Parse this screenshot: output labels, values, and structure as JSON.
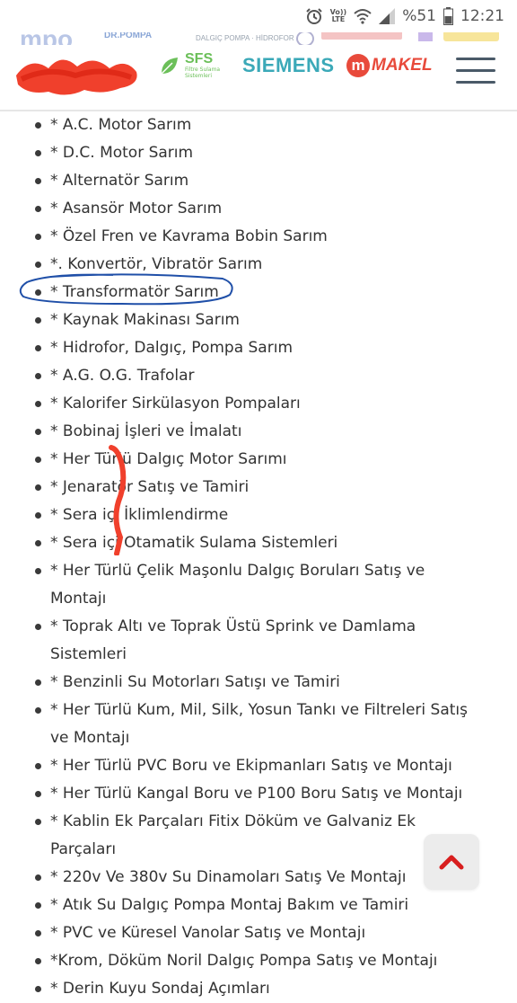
{
  "status_bar": {
    "volte": "Vo))",
    "lte": "LTE",
    "battery": "%51",
    "time": "12:21"
  },
  "header": {
    "brand_strip": [
      "DALGIÇ POMPA · HİDROFOR"
    ],
    "logos": {
      "sfs": "SFS",
      "sfs_sub": "Filtre Sulama Sistemleri",
      "siemens": "SIEMENS",
      "makel_mark": "m",
      "makel": "MAKEL"
    }
  },
  "services": [
    "* A.C. Motor Sarım",
    "* D.C. Motor Sarım",
    "* Alternatör Sarım",
    "* Asansör Motor Sarım",
    "* Özel Fren ve Kavrama Bobin Sarım",
    "*. Konvertör, Vibratör Sarım",
    "* Transformatör Sarım",
    "* Kaynak Makinası Sarım",
    "* Hidrofor, Dalgıç, Pompa Sarım",
    "* A.G. O.G. Trafolar",
    "* Kalorifer Sirkülasyon Pompaları",
    "* Bobinaj İşleri ve İmalatı",
    "* Her Türlü Dalgıç Motor Sarımı",
    "* Jenaratör Satış ve  Tamiri",
    "* Sera içi İklimlendirme",
    "* Sera içi Otamatik Sulama Sistemleri",
    "* Her Türlü Çelik Maşonlu Dalgıç Boruları Satış ve Montajı",
    "* Toprak Altı ve Toprak Üstü Sprink ve Damlama Sistemleri",
    "* Benzinli Su Motorları Satışı ve Tamiri",
    "* Her Türlü Kum, Mil, Silk, Yosun Tankı ve Filtreleri Satış ve Montajı",
    "* Her Türlü PVC Boru ve Ekipmanları Satış ve Montajı",
    "* Her Türlü Kangal Boru ve P100 Boru Satış ve Montajı",
    "* Kablin Ek Parçaları Fitix Döküm ve Galvaniz Ek Parçaları",
    "* 220v Ve 380v Su Dinamoları Satış Ve Montajı",
    "* Atık Su Dalgıç Pompa Montaj Bakım ve Tamiri",
    "* PVC ve Küresel Vanolar Satış ve Montajı",
    "*Krom, Döküm Noril  Dalgıç Pompa Satış ve Montajı",
    "* Derin Kuyu Sondaj Açımları"
  ],
  "colors": {
    "annotation_blue": "#1f4fa8",
    "annotation_red": "#f0402c",
    "siemens": "#3ba9b8",
    "makel": "#e84a3b",
    "sfs": "#6bbf59",
    "scroll_arrow": "#d81e1e"
  },
  "icons": {
    "alarm": "alarm-icon",
    "wifi": "wifi-icon",
    "signal": "signal-icon",
    "battery": "battery-icon",
    "menu": "hamburger-menu-icon",
    "scroll_top": "chevron-up-icon"
  }
}
